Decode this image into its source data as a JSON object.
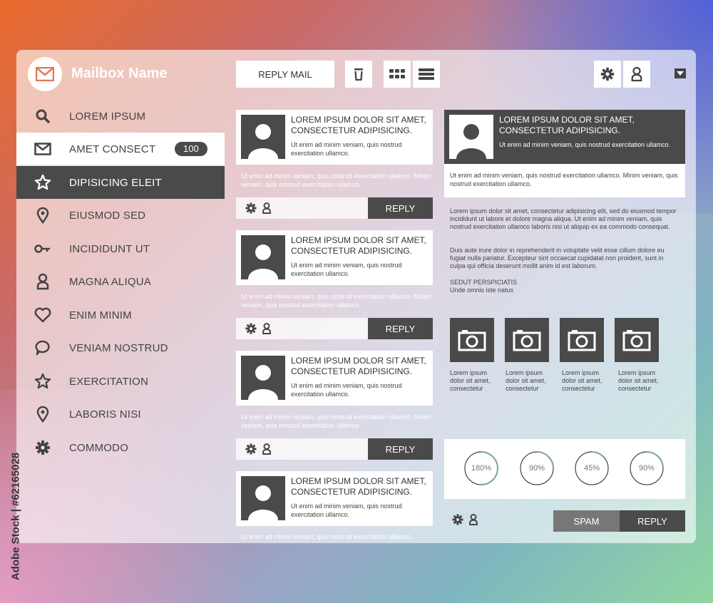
{
  "sidebar": {
    "title": "Mailbox Name",
    "items": [
      {
        "label": "LOREM IPSUM",
        "icon": "search-icon"
      },
      {
        "label": "AMET CONSECT",
        "icon": "mail-icon",
        "badge": "100"
      },
      {
        "label": "DIPISICING ELEIT",
        "icon": "star-icon"
      },
      {
        "label": "EIUSMOD SED",
        "icon": "location-pin-icon"
      },
      {
        "label": "INCIDIDUNT UT",
        "icon": "key-icon"
      },
      {
        "label": "MAGNA ALIQUA",
        "icon": "user-icon"
      },
      {
        "label": "ENIM MINIM",
        "icon": "heart-icon"
      },
      {
        "label": "VENIAM NOSTRUD",
        "icon": "chat-bubble-icon"
      },
      {
        "label": "EXERCITATION",
        "icon": "star-icon"
      },
      {
        "label": "LABORIS NISI",
        "icon": "location-pin-icon"
      },
      {
        "label": "COMMODO",
        "icon": "gear-icon"
      }
    ]
  },
  "toolbar": {
    "reply_mail": "REPLY MAIL",
    "icons": [
      "trash-icon",
      "grid-icon",
      "list-icon",
      "gear-icon",
      "user-icon",
      "dropdown-arrow-icon"
    ]
  },
  "messages": [
    {
      "title": "LOREM IPSUM DOLOR SIT AMET, CONSECTETUR ADIPISICING.",
      "body": "Ut enim ad minim veniam, quis nostrud exercitation ullamco.",
      "footer": "Ut enim ad minim veniam, quis nostrud exercitation ullamco. Minim veniam, quis nostrud exercitation ullamco.",
      "reply": "REPLY"
    },
    {
      "title": "LOREM IPSUM DOLOR SIT AMET, CONSECTETUR ADIPISICING.",
      "body": "Ut enim ad minim veniam, quis nostrud exercitation ullamco.",
      "footer": "Ut enim ad minim veniam, quis nostrud exercitation ullamco. Minim veniam, quis nostrud exercitation ullamco.",
      "reply": "REPLY"
    },
    {
      "title": "LOREM IPSUM DOLOR SIT AMET, CONSECTETUR ADIPISICING.",
      "body": "Ut enim ad minim veniam, quis nostrud exercitation ullamco.",
      "footer": "Ut enim ad minim veniam, quis nostrud exercitation ullamco. Minim veniam, quis nostrud exercitation ullamco.",
      "reply": "REPLY"
    },
    {
      "title": "LOREM IPSUM DOLOR SIT AMET, CONSECTETUR ADIPISICING.",
      "body": "Ut enim ad minim veniam, quis nostrud exercitation ullamco.",
      "footer": "Ut enim ad minim veniam, quis nostrud exercitation ullamco."
    }
  ],
  "reading_pane": {
    "title": "LOREM IPSUM DOLOR SIT AMET, CONSECTETUR ADIPISICING.",
    "body": "Ut enim ad minim veniam, quis nostrud exercitation ullamco.",
    "footer": "Ut enim ad minim veniam, quis nostrud exercitation ullamco. Minim veniam, quis nostrud exercitation ullamco.",
    "paragraph1": "Lorem ipsum dolor sit amet, consectetur adipisicing elit, sed do eiusmod tempor incididunt ut labore et dolore magna aliqua. Ut enim ad minim veniam, quis nostrud exercitation ullamco laboris nisi ut aliquip ex ea commodo consequat.",
    "paragraph2": "Duis aute irure dolor in reprehenderit in voluptate velit esse cillum dolore eu fugiat nulla pariatur. Excepteur sint occaecat cupidatat non proident, sunt in culpa qui officia deserunt mollit anim id est laborum.",
    "signature_line1": "SEDUT PERSPICIATIS",
    "signature_line2": "Unde omnis iste natus",
    "attachments": [
      {
        "caption": "Lorem ipsum dolor sit amet, consectetur"
      },
      {
        "caption": "Lorem ipsum dolor sit amet, consectetur"
      },
      {
        "caption": "Lorem ipsum dolor sit amet, consectetur"
      },
      {
        "caption": "Lorem ipsum dolor sit amet, consectetur"
      }
    ],
    "gauges": [
      {
        "label": "180%",
        "fraction": 0.5
      },
      {
        "label": "90%",
        "fraction": 0.25
      },
      {
        "label": "45%",
        "fraction": 0.125
      },
      {
        "label": "90%",
        "fraction": 0.25
      }
    ],
    "spam": "SPAM",
    "reply": "REPLY"
  },
  "watermark_credit": "Adobe Stock | #62165028",
  "colors": {
    "dark": "#4a4a4a",
    "white": "#ffffff",
    "gauge": "#7aa89a"
  }
}
